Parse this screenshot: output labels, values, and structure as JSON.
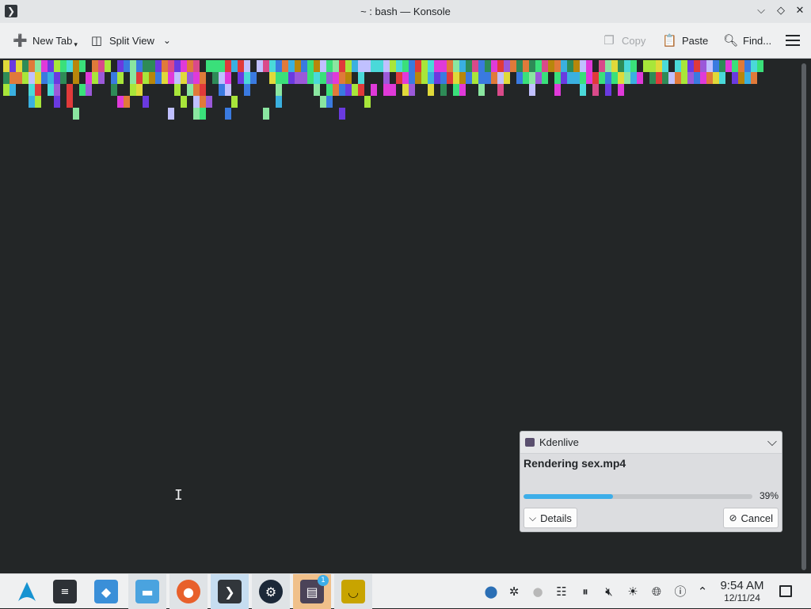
{
  "window": {
    "title": "~ : bash — Konsole",
    "app_icon": "terminal-prompt-icon",
    "controls": [
      "minimize-icon",
      "maximize-icon",
      "close-icon"
    ]
  },
  "toolbar": {
    "new_tab_label": "New Tab",
    "split_view_label": "Split View",
    "copy_label": "Copy",
    "paste_label": "Paste",
    "find_label": "Find...",
    "menu_icon": "hamburger-icon"
  },
  "terminal": {
    "background": "#232627",
    "glitch_colors": [
      "#4ad9d9",
      "#e03ad9",
      "#a8e63a",
      "#6a3ae0",
      "#e03a3a",
      "#3a7ae0",
      "#e07a3a",
      "#3ae07a",
      "#e0d93a",
      "#9b59d9",
      "#d94a8a",
      "#3ab0e0",
      "#8ae6a0",
      "#c0c0ff",
      "#2e8b57",
      "#b8860b"
    ]
  },
  "notification": {
    "app_name": "Kdenlive",
    "heading": "Rendering sex.mp4",
    "progress": 0.39,
    "progress_label": "39%",
    "details_label": "Details",
    "cancel_label": "Cancel",
    "accent_color": "#3daee9"
  },
  "taskbar": {
    "apps": [
      {
        "name": "application-launcher",
        "icon": "arch-linux-icon"
      },
      {
        "name": "system-settings",
        "icon": "settings-sliders-icon"
      },
      {
        "name": "discover",
        "icon": "discover-store-icon"
      },
      {
        "name": "dolphin",
        "icon": "folder-icon"
      },
      {
        "name": "firefox",
        "icon": "firefox-icon"
      },
      {
        "name": "konsole",
        "icon": "terminal-icon"
      },
      {
        "name": "steam",
        "icon": "steam-icon"
      },
      {
        "name": "kdenlive",
        "icon": "kdenlive-icon"
      },
      {
        "name": "banana",
        "icon": "banana-icon"
      }
    ],
    "kdenlive_badge": "1",
    "tray": [
      "updates-icon",
      "network-share-icon",
      "disc-icon",
      "clipboard-icon",
      "media-pause-icon",
      "volume-muted-icon",
      "brightness-icon",
      "globe-network-icon",
      "help-icon",
      "expand-tray-icon"
    ],
    "time": "9:54 AM",
    "date": "12/11/24"
  }
}
